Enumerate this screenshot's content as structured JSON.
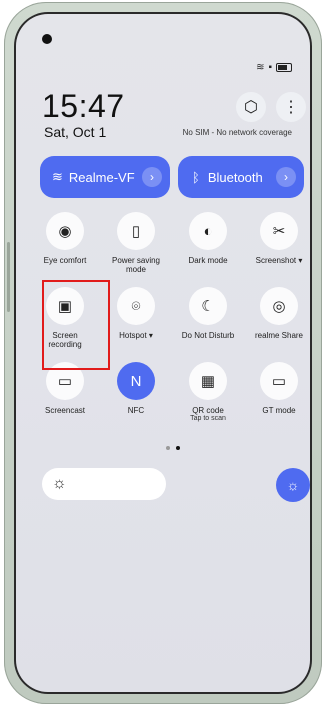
{
  "status": {
    "time": "15:47",
    "date": "Sat, Oct 1",
    "network": "No SIM - No network coverage"
  },
  "header": {
    "settings_icon": "gear-hex-icon",
    "menu_icon": "more-vertical-icon"
  },
  "wifi": {
    "label": "Realme-VF",
    "icon": "wifi-icon",
    "arrow": "›"
  },
  "bluetooth": {
    "label": "Bluetooth",
    "icon": "bluetooth-icon",
    "arrow": "›"
  },
  "tiles": [
    {
      "label": "Eye comfort",
      "sub": "",
      "icon": "eye-icon",
      "active": false
    },
    {
      "label": "Power saving mode",
      "sub": "",
      "icon": "battery-saver-icon",
      "active": false
    },
    {
      "label": "Dark mode",
      "sub": "",
      "icon": "dark-mode-icon",
      "active": false
    },
    {
      "label": "Screenshot ▾",
      "sub": "",
      "icon": "screenshot-icon",
      "active": false
    },
    {
      "label": "Screen recording",
      "sub": "",
      "icon": "screen-record-icon",
      "active": false
    },
    {
      "label": "Hotspot ▾",
      "sub": "",
      "icon": "hotspot-icon",
      "active": false
    },
    {
      "label": "Do Not Disturb",
      "sub": "",
      "icon": "moon-icon",
      "active": false
    },
    {
      "label": "realme Share",
      "sub": "",
      "icon": "share-icon",
      "active": false
    },
    {
      "label": "Screencast",
      "sub": "",
      "icon": "cast-icon",
      "active": false
    },
    {
      "label": "NFC",
      "sub": "",
      "icon": "nfc-icon",
      "active": true
    },
    {
      "label": "QR code",
      "sub": "Tap to scan",
      "icon": "qr-icon",
      "active": false
    },
    {
      "label": "GT mode",
      "sub": "",
      "icon": "gt-mode-icon",
      "active": false
    }
  ],
  "brightness": {
    "icon": "sun-icon",
    "auto_icon": "auto-brightness-icon"
  },
  "colors": {
    "accent": "#4f6bf0",
    "highlight": "#e11b1b"
  }
}
